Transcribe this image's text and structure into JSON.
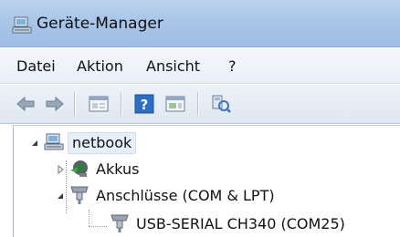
{
  "window": {
    "title": "Geräte-Manager"
  },
  "menu": {
    "items": [
      {
        "label": "Datei"
      },
      {
        "label": "Aktion"
      },
      {
        "label": "Ansicht"
      },
      {
        "label": "?"
      }
    ]
  },
  "toolbar": {
    "buttons": [
      {
        "icon": "back-arrow-icon"
      },
      {
        "icon": "forward-arrow-icon"
      },
      {
        "icon": "properties-window-icon"
      },
      {
        "icon": "help-icon"
      },
      {
        "icon": "show-hidden-window-icon"
      },
      {
        "icon": "scan-hardware-icon"
      }
    ]
  },
  "tree": {
    "root": {
      "label": "netbook",
      "icon": "computer-icon",
      "expanded": true
    },
    "children": [
      {
        "label": "Akkus",
        "icon": "battery-icon",
        "expanded": false
      },
      {
        "label": "Anschlüsse (COM & LPT)",
        "icon": "port-connector-icon",
        "expanded": true,
        "children": [
          {
            "label": "USB-SERIAL CH340 (COM25)",
            "icon": "port-connector-icon"
          }
        ]
      }
    ]
  },
  "colors": {
    "titlebar": "#a9c6e8",
    "selection": "#e5eef9",
    "help_icon": "#2b6ec9"
  }
}
